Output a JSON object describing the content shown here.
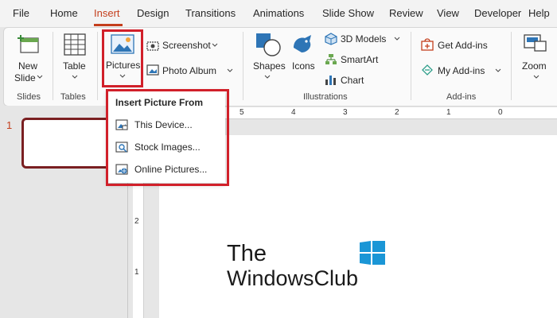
{
  "menu_tabs": [
    "File",
    "Home",
    "Insert",
    "Design",
    "Transitions",
    "Animations",
    "Slide Show",
    "Review",
    "View",
    "Developer",
    "Help"
  ],
  "ribbon": {
    "new_slide": {
      "line1": "New",
      "line2": "Slide"
    },
    "table": "Table",
    "pictures": "Pictures",
    "screenshot": "Screenshot",
    "photo_album": "Photo Album",
    "shapes": "Shapes",
    "icons": "Icons",
    "models_3d": "3D Models",
    "smartart": "SmartArt",
    "chart": "Chart",
    "get_addins": "Get Add-ins",
    "my_addins": "My Add-ins",
    "zoom": "Zoom",
    "groups": {
      "slides": "Slides",
      "tables": "Tables",
      "illustrations": "Illustrations",
      "addins": "Add-ins"
    }
  },
  "dropdown": {
    "title": "Insert Picture From",
    "items": [
      "This Device...",
      "Stock Images...",
      "Online Pictures..."
    ]
  },
  "thumbnail": {
    "number": "1"
  },
  "ruler": {
    "h": [
      "5",
      "4",
      "3",
      "2",
      "1",
      "0"
    ],
    "v": [
      "2",
      "1"
    ]
  },
  "watermark": {
    "line1": "The",
    "line2": "WindowsClub"
  },
  "colors": {
    "accent": "#c43e1c",
    "highlight": "#d1202a",
    "thumb_border": "#7a1f21"
  }
}
